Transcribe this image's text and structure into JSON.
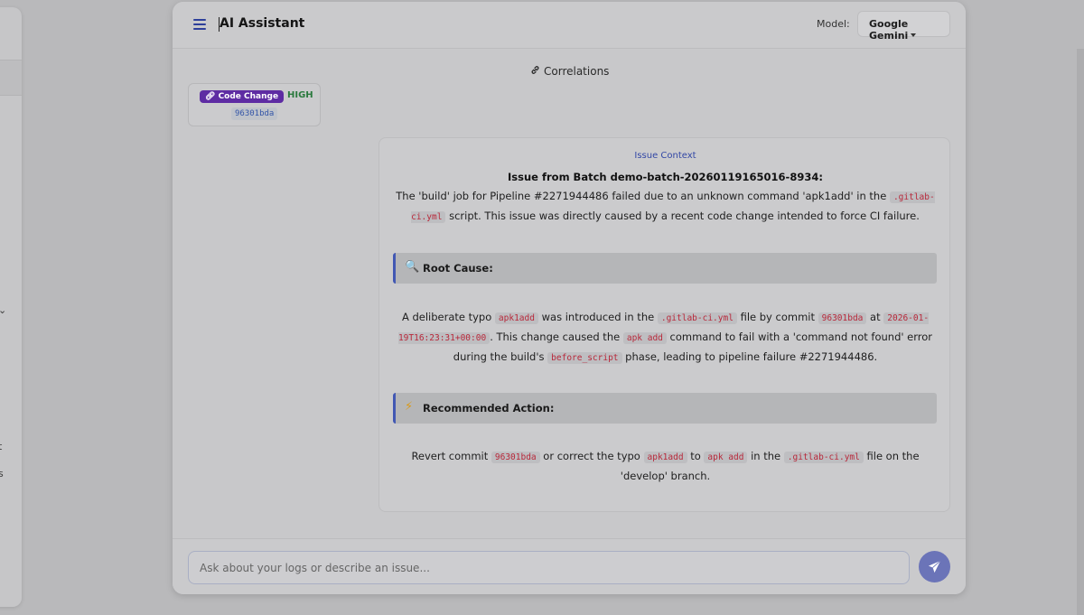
{
  "background": {
    "left_fragments": [
      "t",
      "s"
    ]
  },
  "header": {
    "title": "AI Assistant",
    "model_label": "Model:",
    "model_selected": "Google Gemini"
  },
  "correlations": {
    "title": "Correlations",
    "item": {
      "badge_label": "Code Change",
      "severity": "HIGH",
      "commit": "96301bda"
    }
  },
  "issue": {
    "context_label": "Issue Context",
    "title": "Issue from Batch demo-batch-20260119165016-8934:",
    "summary": {
      "p1": "The 'build' job for Pipeline #2271944486 failed due to an unknown command 'apk1add' in the ",
      "code1": ".gitlab-ci.yml",
      "p2": " script. This issue was directly caused by a recent code change intended to force CI failure."
    },
    "root_cause": {
      "heading": "Root Cause:",
      "t1": "A deliberate typo ",
      "c1": "apk1add",
      "t2": " was introduced in the ",
      "c2": ".gitlab-ci.yml",
      "t3": " file by commit ",
      "c3": "96301bda",
      "t4": " at ",
      "c4": "2026-01-19T16:23:31+00:00",
      "t5": ". This change caused the ",
      "c5": "apk add",
      "t6": " command to fail with a 'command not found' error during the build's ",
      "c6": "before_script",
      "t7": " phase, leading to pipeline failure #2271944486."
    },
    "action": {
      "heading": "Recommended Action:",
      "t1": "Revert commit ",
      "c1": "96301bda",
      "t2": " or correct the typo ",
      "c2": "apk1add",
      "t3": " to ",
      "c3": "apk add",
      "t4": " in the ",
      "c4": ".gitlab-ci.yml",
      "t5": " file on the 'develop' branch."
    }
  },
  "input": {
    "placeholder": "Ask about your logs or describe an issue..."
  },
  "colors": {
    "accent": "#4258b3",
    "badge": "#5e2ca3",
    "severity_high": "#2b7a3e",
    "code_text": "#b8283a"
  },
  "icons": {
    "menu": "hamburger-icon",
    "link": "link-icon",
    "root_cause": "magnifier-icon",
    "action": "lightning-icon",
    "send": "paper-plane-icon"
  }
}
